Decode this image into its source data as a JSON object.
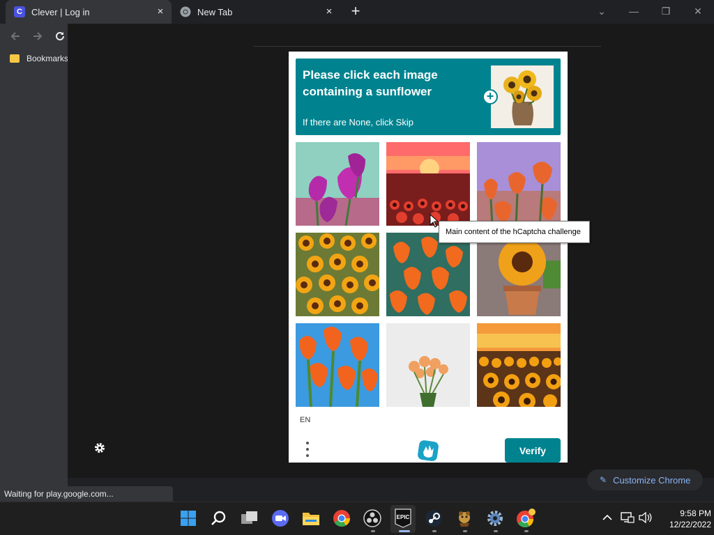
{
  "browser": {
    "tabs": [
      {
        "title": "Clever | Log in",
        "favicon": "clever-c-icon",
        "favicon_letter": "C",
        "active": true
      },
      {
        "title": "New Tab",
        "favicon": "chrome-icon",
        "active": false
      }
    ],
    "close_glyph": "×",
    "new_tab_glyph": "+",
    "window_controls": {
      "dropdown": "⌄",
      "minimize": "—",
      "restore": "❐",
      "close": "✕"
    },
    "bookmarks_folder": "Bookmarks",
    "status_text": "Waiting for play.google.com...",
    "customize_label": "Customize Chrome",
    "accent_color": "#8ab4f8"
  },
  "captcha": {
    "prompt_title": "Please click each image containing a sunflower",
    "prompt_subtitle": "If there are None, click Skip",
    "example_image": "sunflower-vase-image",
    "grid": [
      {
        "subject": "purple-tulips"
      },
      {
        "subject": "sunflower-field-sunset"
      },
      {
        "subject": "orange-tulips-sky"
      },
      {
        "subject": "sunflower-field"
      },
      {
        "subject": "orange-tulips-field"
      },
      {
        "subject": "sunflower-pot"
      },
      {
        "subject": "orange-tulips-blue-sky"
      },
      {
        "subject": "tulip-bouquet"
      },
      {
        "subject": "sunflower-field-sunset-2"
      }
    ],
    "language": "EN",
    "verify_label": "Verify",
    "brand_color": "#00838f",
    "tooltip": "Main content of the hCaptcha challenge"
  },
  "taskbar": {
    "apps": [
      "windows-start-icon",
      "search-icon",
      "task-view-icon",
      "zoom-icon",
      "file-explorer-icon",
      "chrome-icon",
      "obs-icon",
      "epic-games-icon",
      "steam-icon",
      "game-icon",
      "settings-icon",
      "chrome-profile-icon"
    ],
    "epic_label": "EPIC",
    "time": "9:58 PM",
    "date": "12/22/2022"
  }
}
